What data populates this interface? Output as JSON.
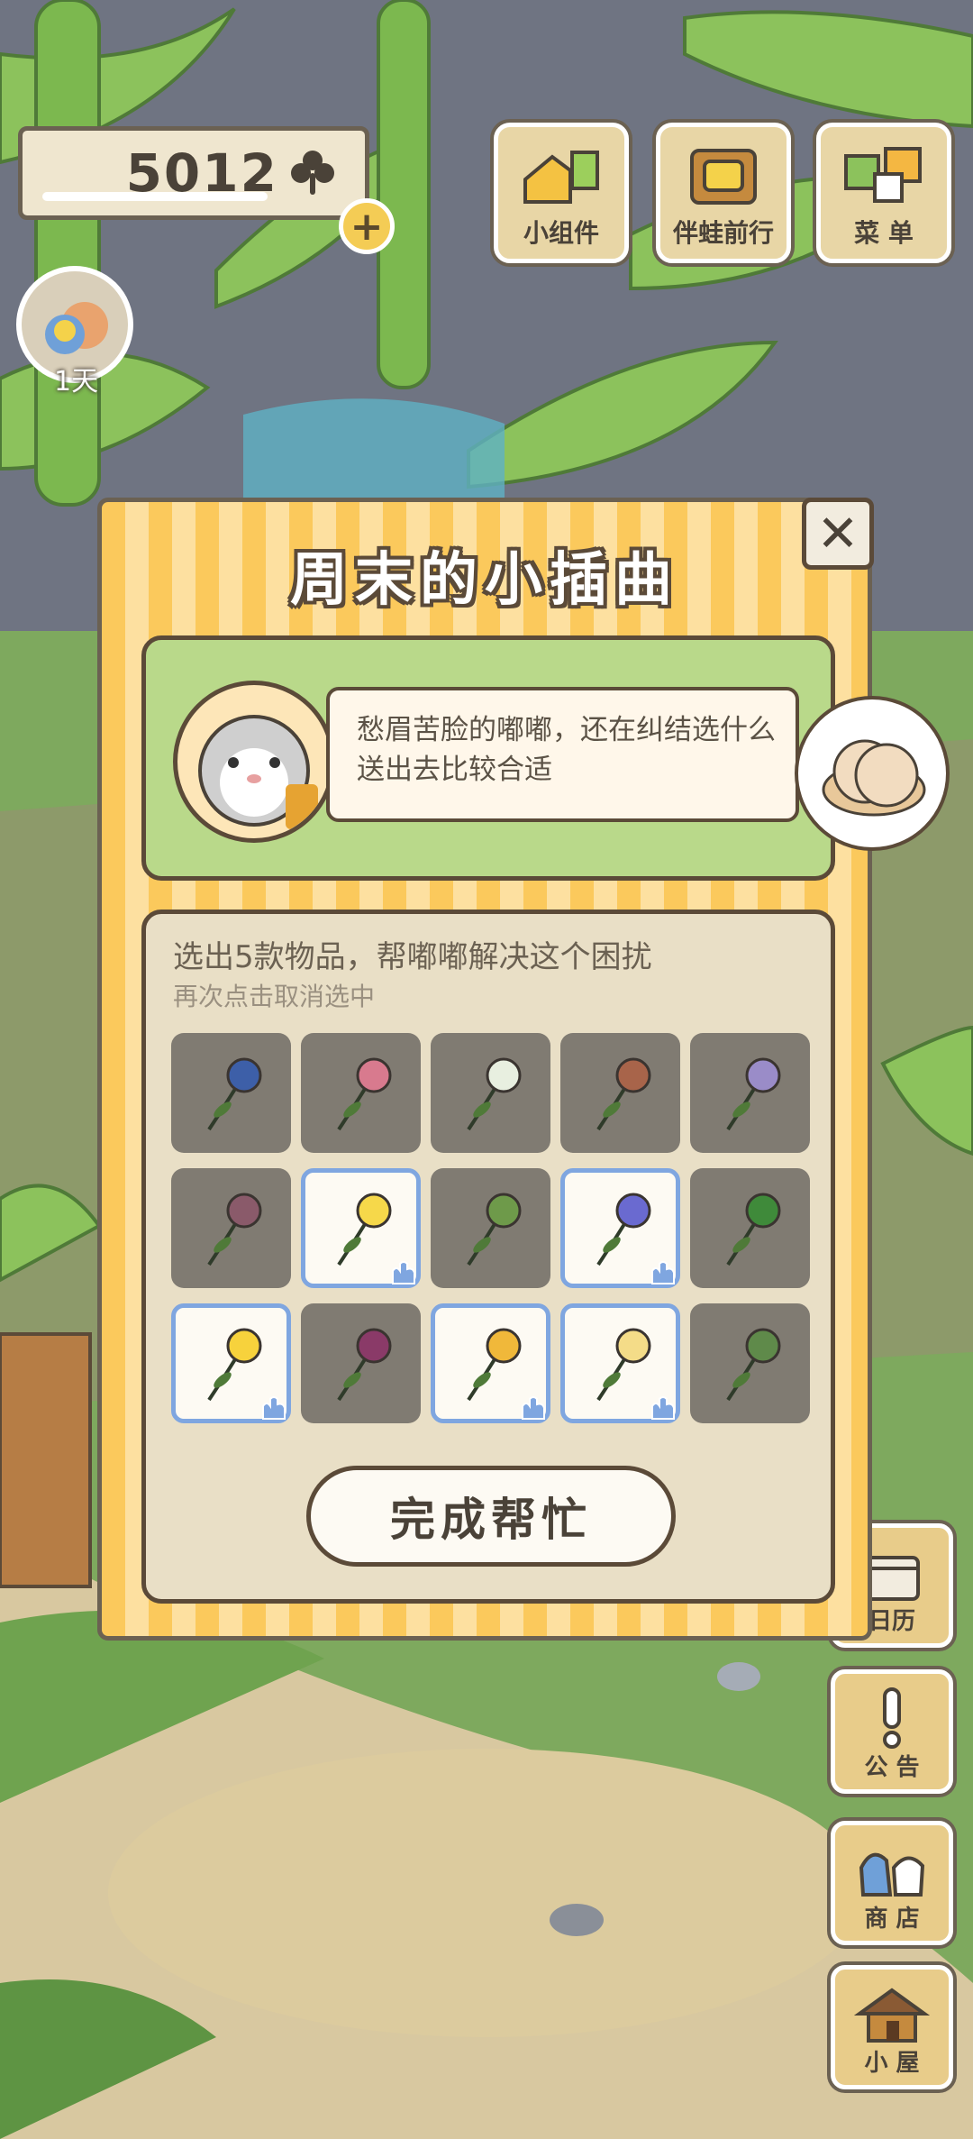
{
  "hud": {
    "clover_count": "5012",
    "avatar_days": "1天"
  },
  "top_buttons": [
    {
      "label": "小组件",
      "icon": "widget-icon"
    },
    {
      "label": "伴蛙前行",
      "icon": "companion-icon"
    },
    {
      "label": "菜 单",
      "icon": "menu-icon"
    }
  ],
  "side_buttons": [
    {
      "label": "日历",
      "icon": "calendar-icon"
    },
    {
      "label": "公 告",
      "icon": "notice-icon"
    },
    {
      "label": "商 店",
      "icon": "shop-icon"
    },
    {
      "label": "小 屋",
      "icon": "house-icon"
    }
  ],
  "modal": {
    "title": "周末的小插曲",
    "story_text": "愁眉苦脸的嘟嘟，还在纠结选什么送出去比较合适",
    "select_title": "选出5款物品，帮嘟嘟解决这个困扰",
    "select_hint": "再次点击取消选中",
    "done_label": "完成帮忙",
    "items": [
      {
        "name": "blue-bellflower",
        "selected": false
      },
      {
        "name": "pink-bud-branch",
        "selected": false
      },
      {
        "name": "white-lily",
        "selected": false
      },
      {
        "name": "cattail-spike",
        "selected": false
      },
      {
        "name": "lilac-cluster",
        "selected": false
      },
      {
        "name": "purple-sprig",
        "selected": false
      },
      {
        "name": "yellow-buttercup",
        "selected": true
      },
      {
        "name": "green-sprig",
        "selected": false
      },
      {
        "name": "violet-pansy",
        "selected": true
      },
      {
        "name": "four-leaf-clover",
        "selected": false
      },
      {
        "name": "yellow-tulip",
        "selected": true
      },
      {
        "name": "hibiscus",
        "selected": false
      },
      {
        "name": "osmanthus-branch",
        "selected": true
      },
      {
        "name": "wintersweet-branch",
        "selected": true
      },
      {
        "name": "small-bud",
        "selected": false
      }
    ]
  },
  "colors": {
    "stripe": "#fbc95c",
    "panel": "#e9dfc6",
    "selected_border": "#7fa6e0",
    "green_panel": "#b9d98a"
  }
}
